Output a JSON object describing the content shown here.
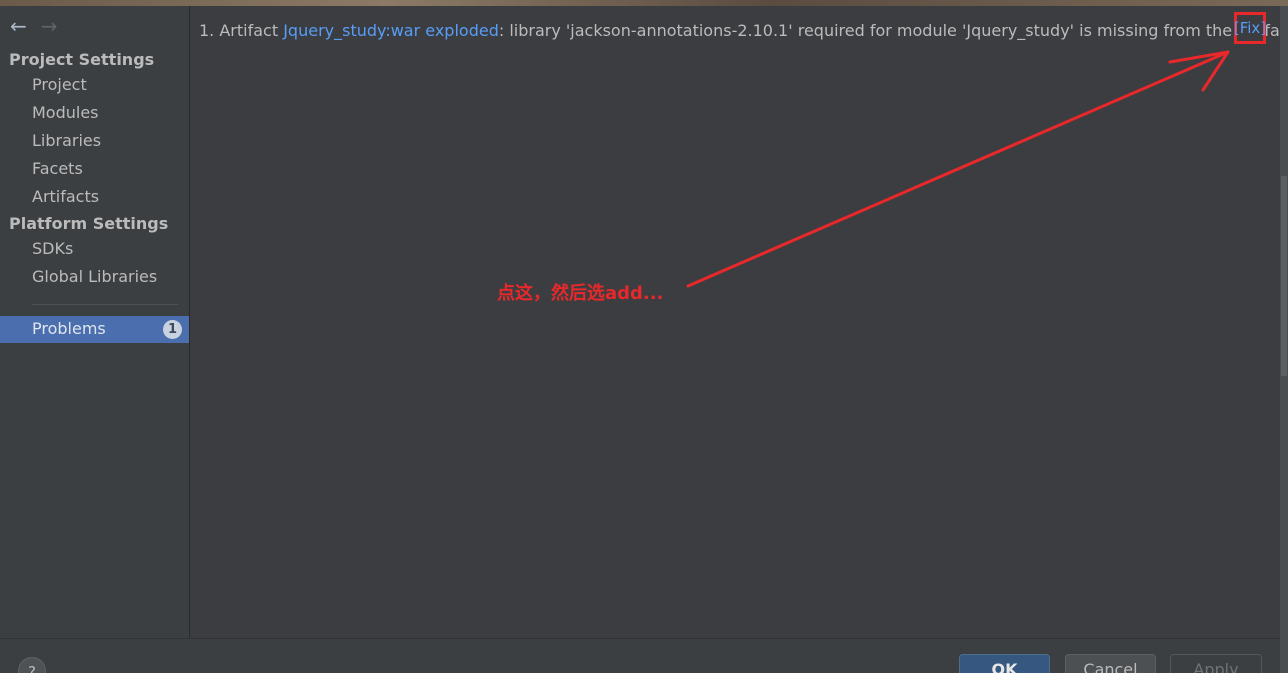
{
  "nav": {
    "back_icon": "←",
    "forward_icon": "→"
  },
  "sidebar": {
    "project_settings_header": "Project Settings",
    "project_items": [
      "Project",
      "Modules",
      "Libraries",
      "Facets",
      "Artifacts"
    ],
    "platform_settings_header": "Platform Settings",
    "platform_items": [
      "SDKs",
      "Global Libraries"
    ],
    "problems": {
      "label": "Problems",
      "count": "1"
    }
  },
  "problems_panel": {
    "index": "1.",
    "prefix": "Artifact",
    "artifact_link": "Jquery_study:war exploded",
    "message": ": library 'jackson-annotations-2.10.1' required for module 'Jquery_study' is missing from the artifact",
    "fix_link": "[Fix]"
  },
  "annotation": {
    "text": "点这，然后选add...",
    "color": "#e8282a"
  },
  "footer": {
    "help_label": "?",
    "ok_label": "OK",
    "cancel_label": "Cancel",
    "apply_label": "Apply"
  },
  "colors": {
    "accent_link": "#589df6",
    "selection": "#4b6eaf",
    "background": "#3c3f41"
  }
}
